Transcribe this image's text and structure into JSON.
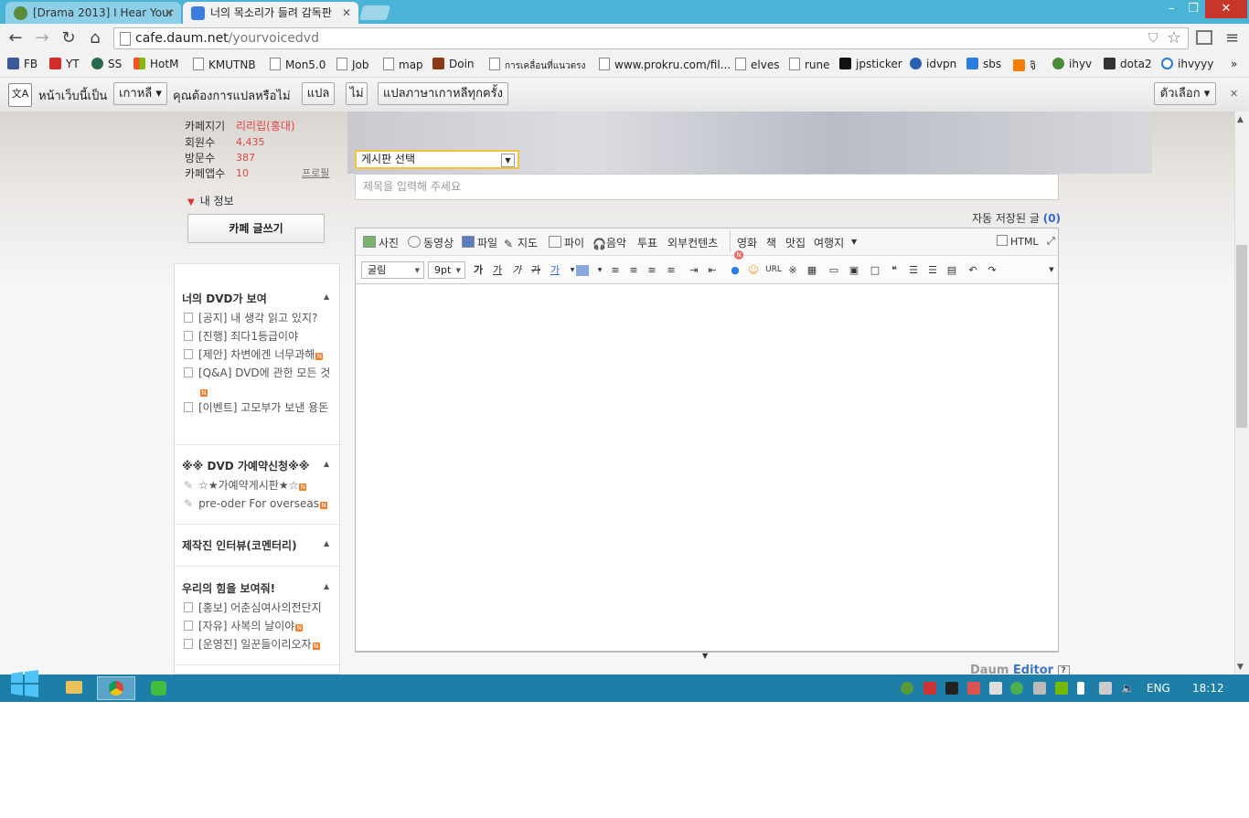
{
  "tabs": [
    {
      "title": "[Drama 2013] I Hear Your",
      "active": false
    },
    {
      "title": "너의 목소리가 들려 감독판",
      "active": true
    }
  ],
  "window_controls": {
    "minimize": "–",
    "restore": "❐",
    "close": "✕"
  },
  "address": {
    "domain": "cafe.daum.net",
    "path": "/yourvoicedvd"
  },
  "bookmarks": [
    "FB",
    "YT",
    "SS",
    "HotM",
    "KMUTNB",
    "Mon5.0",
    "Job",
    "map",
    "Doin",
    "การเคลื่อนที่แนวตรง",
    "www.prokru.com/fil...",
    "elves",
    "rune",
    "jpsticker",
    "idvpn",
    "sbs",
    "จิ",
    "ihyv",
    "dota2",
    "ihvyyy"
  ],
  "bookmarks_more": "»",
  "translate": {
    "prefix": "หน้าเว็บนี้เป็น",
    "language": "เกาหลี",
    "question": "คุณต้องการแปลหรือไม่",
    "translate_btn": "แปล",
    "no_btn": "ไม่",
    "always_btn": "แปลภาษาเกาหลีทุกครั้ง",
    "options_btn": "ตัวเลือก",
    "close": "✕"
  },
  "cafe_info": [
    {
      "label": "카페지기",
      "value": "리리립(홍대)"
    },
    {
      "label": "회원수",
      "value": "4,435"
    },
    {
      "label": "방문수",
      "value": "387"
    },
    {
      "label": "카페앱수",
      "value": "10"
    }
  ],
  "profile_link": "프로필",
  "my_info": "내 정보",
  "write_button": "카페 글쓰기",
  "menu_sections": [
    {
      "title": "너의 DVD가 보여",
      "items": [
        "[공지] 내 생각 읽고 있지?",
        "[진행] 죄다1등급이야",
        "[제안] 차변에겐 너무과해",
        "[Q&A] DVD에 관한 모든 것",
        "[이벤트] 고모부가 보낸 용돈"
      ]
    },
    {
      "title": "※※ DVD 가예약신청※※",
      "items": [
        "☆★가예약게시판★☆",
        "pre-oder For overseas"
      ]
    },
    {
      "title": "제작진 인터뷰(코멘터리)",
      "items": []
    },
    {
      "title": "우리의 힘을 보여줘!",
      "items": [
        "[홍보] 어춘심여사의전단지",
        "[자유] 사복의 날이야",
        "[운영진] 일꾼들이리오자"
      ]
    }
  ],
  "editor": {
    "board_select": "게시판 선택",
    "title_placeholder": "제목을 입력해 주세요",
    "autosave_label": "자동 저장된 글",
    "autosave_count": "(0)",
    "toolbar1": [
      "사진",
      "동영상",
      "파일",
      "지도",
      "파이",
      "음악",
      "투표",
      "외부컨텐츠",
      "영화",
      "책",
      "맛집",
      "여행지"
    ],
    "html_label": "HTML",
    "font": "굴림",
    "size": "9pt",
    "format_btns": [
      "가",
      "가",
      "가",
      "가",
      "가"
    ],
    "url_label": "URL",
    "brand_prefix": "Daum ",
    "brand_suffix": "Editor",
    "help": "?"
  },
  "taskbar": {
    "lang": "ENG",
    "time": "18:12"
  },
  "colors": {
    "titlebar": "#4ab3d6",
    "taskbar": "#1d7fa7",
    "accent_red": "#e04545",
    "badge": "#f07e2a",
    "link_blue": "#3367d6"
  }
}
